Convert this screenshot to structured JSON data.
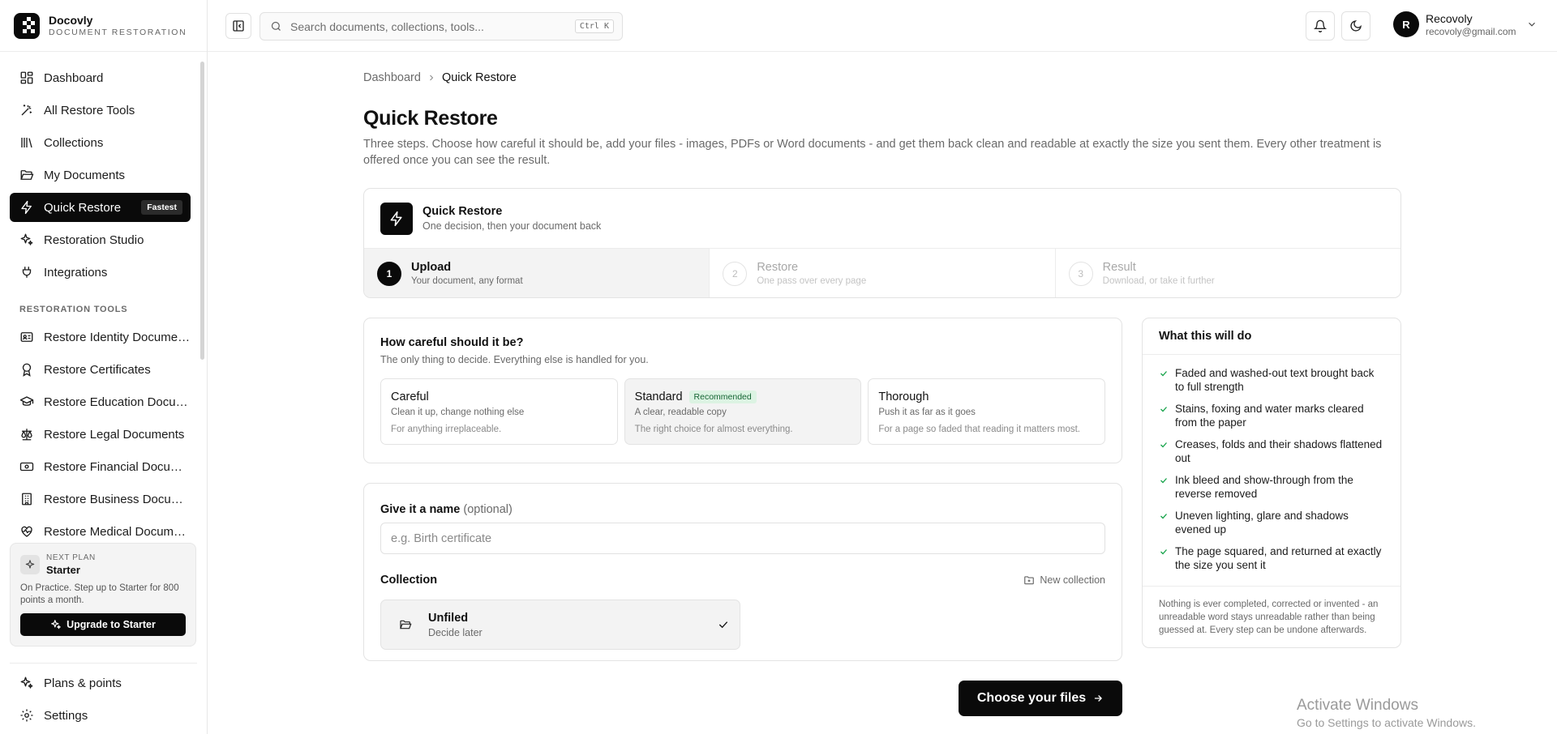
{
  "brand": {
    "name": "Docovly",
    "subtitle": "DOCUMENT RESTORATION"
  },
  "sidebar": {
    "items": [
      {
        "label": "Dashboard",
        "icon": "dashboard-icon"
      },
      {
        "label": "All Restore Tools",
        "icon": "wand-icon"
      },
      {
        "label": "Collections",
        "icon": "library-icon"
      },
      {
        "label": "My Documents",
        "icon": "folder-open-icon"
      },
      {
        "label": "Quick Restore",
        "icon": "bolt-icon",
        "badge": "Fastest",
        "active": true
      },
      {
        "label": "Restoration Studio",
        "icon": "sparkles-icon"
      },
      {
        "label": "Integrations",
        "icon": "plug-icon"
      }
    ],
    "section_label": "RESTORATION TOOLS",
    "tools": [
      {
        "label": "Restore Identity Docume…",
        "icon": "id-card-icon"
      },
      {
        "label": "Restore Certificates",
        "icon": "award-icon"
      },
      {
        "label": "Restore Education Docu…",
        "icon": "graduation-cap-icon"
      },
      {
        "label": "Restore Legal Documents",
        "icon": "scale-icon"
      },
      {
        "label": "Restore Financial Docu…",
        "icon": "banknote-icon"
      },
      {
        "label": "Restore Business Docu…",
        "icon": "building-icon"
      },
      {
        "label": "Restore Medical Docum…",
        "icon": "heart-pulse-icon"
      }
    ],
    "plan": {
      "label": "NEXT PLAN",
      "name": "Starter",
      "description": "On Practice. Step up to Starter for 800 points a month.",
      "button": "Upgrade to Starter"
    },
    "bottom": [
      {
        "label": "Plans & points",
        "icon": "sparkles-icon"
      },
      {
        "label": "Settings",
        "icon": "gear-icon"
      }
    ]
  },
  "header": {
    "search_placeholder": "Search documents, collections, tools...",
    "shortcut": "Ctrl K",
    "user": {
      "initial": "R",
      "name": "Recovoly",
      "email": "recovoly@gmail.com"
    }
  },
  "main": {
    "breadcrumb": {
      "parent": "Dashboard",
      "current": "Quick Restore"
    },
    "title": "Quick Restore",
    "description": "Three steps. Choose how careful it should be, add your files - images, PDFs or Word documents - and get them back clean and readable at exactly the size you sent them. Every other treatment is offered once you can see the result.",
    "stepper": {
      "title": "Quick Restore",
      "subtitle": "One decision, then your document back",
      "steps": [
        {
          "num": "1",
          "label": "Upload",
          "sub": "Your document, any format",
          "active": true
        },
        {
          "num": "2",
          "label": "Restore",
          "sub": "One pass over every page",
          "active": false
        },
        {
          "num": "3",
          "label": "Result",
          "sub": "Download, or take it further",
          "active": false
        }
      ]
    },
    "care": {
      "title": "How careful should it be?",
      "subtitle": "The only thing to decide. Everything else is handled for you.",
      "options": [
        {
          "name": "Careful",
          "desc": "Clean it up, change nothing else",
          "hint": "For anything irreplaceable.",
          "badge": "",
          "selected": false
        },
        {
          "name": "Standard",
          "desc": "A clear, readable copy",
          "hint": "The right choice for almost everything.",
          "badge": "Recommended",
          "selected": true
        },
        {
          "name": "Thorough",
          "desc": "Push it as far as it goes",
          "hint": "For a page so faded that reading it matters most.",
          "badge": "",
          "selected": false
        }
      ]
    },
    "naming": {
      "label": "Give it a name",
      "optional": "(optional)",
      "placeholder": "e.g. Birth certificate",
      "collection_label": "Collection",
      "new_collection": "New collection",
      "collection_name": "Unfiled",
      "collection_sub": "Decide later"
    },
    "cta": "Choose your files"
  },
  "side": {
    "title": "What this will do",
    "items": [
      "Faded and washed-out text brought back to full strength",
      "Stains, foxing and water marks cleared from the paper",
      "Creases, folds and their shadows flattened out",
      "Ink bleed and show-through from the reverse removed",
      "Uneven lighting, glare and shadows evened up",
      "The page squared, and returned at exactly the size you sent it"
    ],
    "footnote": "Nothing is ever completed, corrected or invented - an unreadable word stays unreadable rather than being guessed at. Every step can be undone afterwards."
  },
  "watermark": {
    "line1": "Activate Windows",
    "line2": "Go to Settings to activate Windows."
  },
  "colors": {
    "accent": "#0a0a0a",
    "badge_green_bg": "#dcf3e3",
    "badge_green_text": "#166534",
    "check": "#16a34a"
  }
}
